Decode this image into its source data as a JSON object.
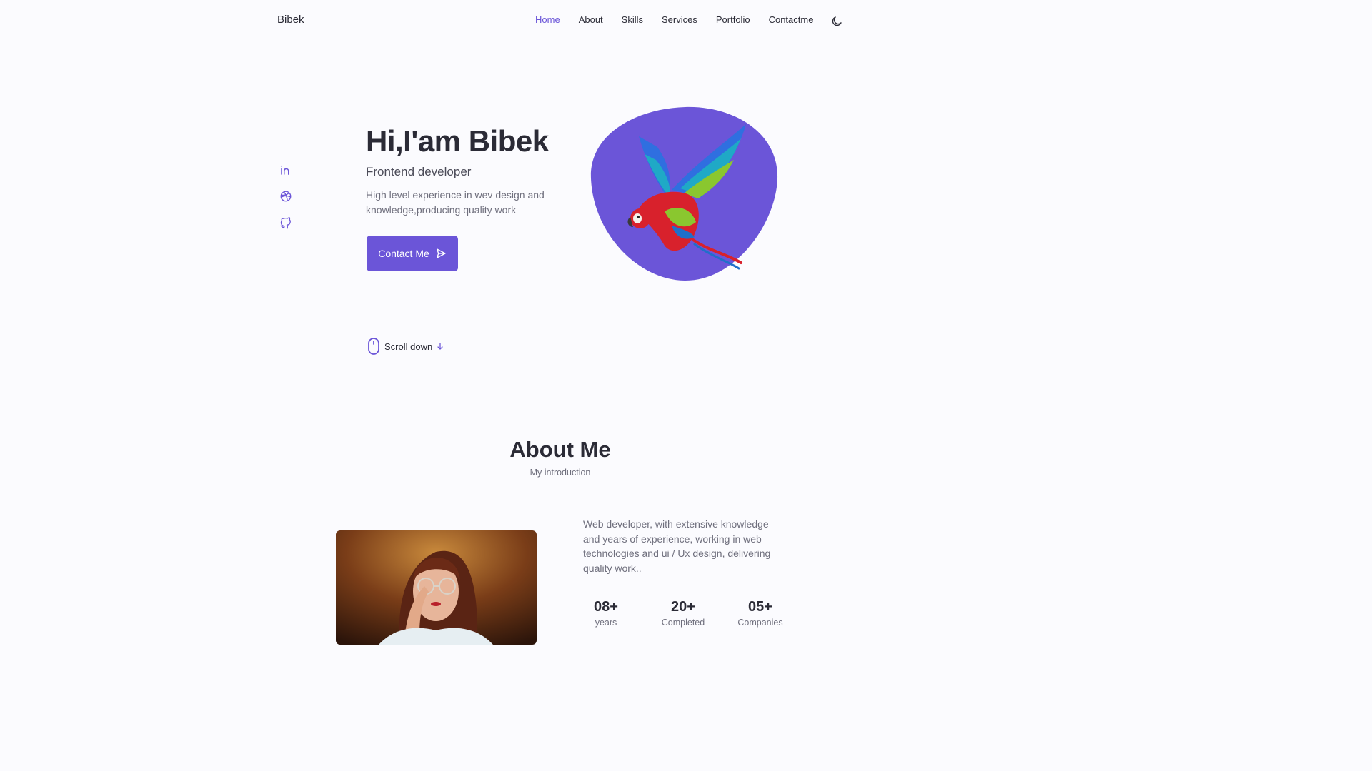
{
  "header": {
    "logo": "Bibek",
    "nav": [
      {
        "label": "Home",
        "active": true
      },
      {
        "label": "About"
      },
      {
        "label": "Skills"
      },
      {
        "label": "Services"
      },
      {
        "label": "Portfolio"
      },
      {
        "label": "Contactme"
      }
    ],
    "theme_icon": "moon-icon"
  },
  "social": [
    "linkedin-icon",
    "dribbble-icon",
    "github-icon"
  ],
  "hero": {
    "title": "Hi,I'am Bibek",
    "subtitle": "Frontend developer",
    "description": "High level experience in wev design and knowledge,producing quality work",
    "button_label": "Contact Me",
    "scroll_label": "Scroll down"
  },
  "about": {
    "title": "About Me",
    "subtitle": "My introduction",
    "description": "Web developer, with extensive knowledge and years of experience, working in web technologies and ui / Ux design, delivering quality work..",
    "stats": [
      {
        "number": "08+",
        "label": "years"
      },
      {
        "number": "20+",
        "label": "Completed"
      },
      {
        "number": "05+",
        "label": "Companies"
      }
    ]
  },
  "colors": {
    "accent": "#6b55d8",
    "text": "#2b2b36",
    "muted": "#6e6e7c",
    "background": "#fbfbfe"
  }
}
